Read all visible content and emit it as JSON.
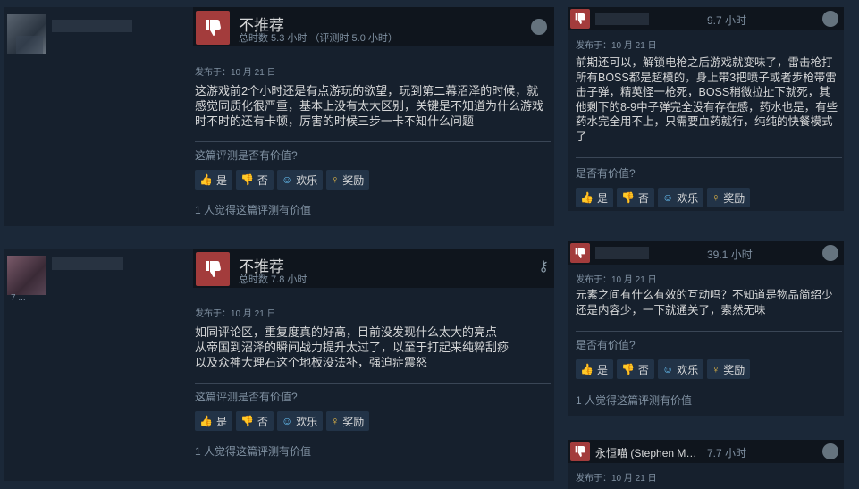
{
  "left_reviews": [
    {
      "verdict": "不推荐",
      "hours": "总时数 5.3 小时 （评测时 5.0 小时）",
      "posted": "发布于：10 月 21 日",
      "content": "这游戏前2个小时还是有点游玩的欲望，玩到第二幕沼泽的时候，就感觉同质化很严重，基本上没有太大区别，关键是不知道为什么游戏时不时的还有卡顿，厉害的时候三步一卡不知什么问题",
      "helpful_question": "这篇评测是否有价值?",
      "found_helpful": "1 人觉得这篇评测有价值"
    },
    {
      "verdict": "不推荐",
      "hours": "总时数 7.8 小时",
      "posted": "发布于：10 月 21 日",
      "content": "如同评论区，重复度真的好高，目前没发现什么太大的亮点\n从帝国到沼泽的瞬间战力提升太过了，以至于打起来纯粹刮痧\n以及众神大理石这个地板没法补，强迫症震怒",
      "helpful_question": "这篇评测是否有价值?",
      "found_helpful": "1 人觉得这篇评测有价值"
    }
  ],
  "right_reviews": [
    {
      "name": "",
      "hours": "9.7 小时",
      "posted": "发布于：10 月 21 日",
      "content": "前期还可以，解锁电枪之后游戏就变味了，雷击枪打所有BOSS都是超模的，身上带3把喷子或者步枪带雷击子弹，精英怪一枪死，BOSS稍微拉扯下就死，其他剩下的8-9中子弹完全没有存在感，药水也是，有些药水完全用不上，只需要血药就行，纯纯的快餐模式了",
      "helpful_question": "是否有价值?",
      "found_helpful": ""
    },
    {
      "name": "",
      "hours": "39.1 小时",
      "posted": "发布于：10 月 21 日",
      "content": "元素之间有什么有效的互动吗？不知道是物品简绍少还是内容少，一下就通关了，索然无味",
      "helpful_question": "是否有价值?",
      "found_helpful": "1 人觉得这篇评测有价值"
    },
    {
      "name": "永恒喵 (Stephen M…",
      "hours": "7.7 小时",
      "posted": "发布于：10 月 21 日",
      "content": "",
      "helpful_question": "",
      "found_helpful": ""
    }
  ],
  "buttons": {
    "yes": "是",
    "no": "否",
    "funny": "欢乐",
    "award": "奖励"
  },
  "cut_text": {
    "top_right": "",
    "left_author2_line": "7 ..."
  },
  "colors": {
    "not_recommended": "#a33c3c",
    "background": "#1b2838",
    "panel": "#16202d",
    "accent_blue": "#67c1f5",
    "award_gold": "#f3c246"
  },
  "icons": {
    "thumb_down": "thumb-down-icon",
    "steam": "steam-icon",
    "key": "key-icon",
    "vote_up": "thumb-up-icon",
    "vote_down": "thumb-down-icon",
    "funny": "smiley-icon",
    "award": "award-icon"
  }
}
